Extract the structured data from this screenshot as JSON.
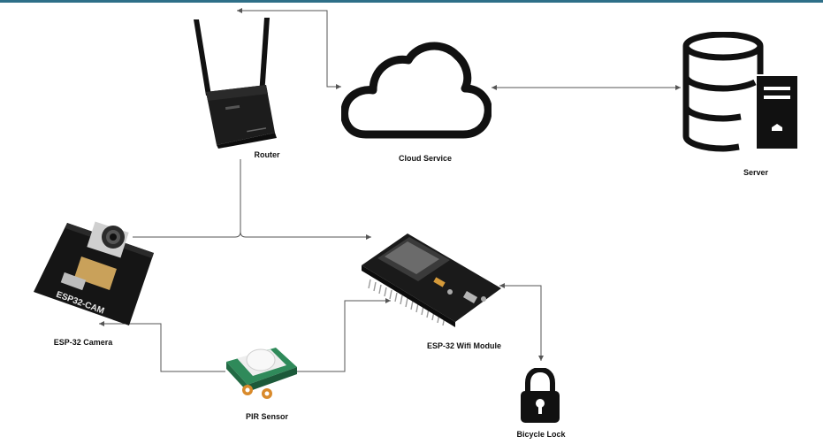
{
  "nodes": {
    "router": {
      "label": "Router"
    },
    "cloud": {
      "label": "Cloud Service"
    },
    "server": {
      "label": "Server"
    },
    "camera": {
      "label": "ESP-32  Camera",
      "board_text": "ESP32-CAM"
    },
    "wifi": {
      "label": "ESP-32  Wifi Module"
    },
    "pir": {
      "label": "PIR Sensor"
    },
    "lock": {
      "label": "Bicycle Lock"
    }
  },
  "colors": {
    "accent_bar": "#2e6f88",
    "line": "#555555"
  }
}
